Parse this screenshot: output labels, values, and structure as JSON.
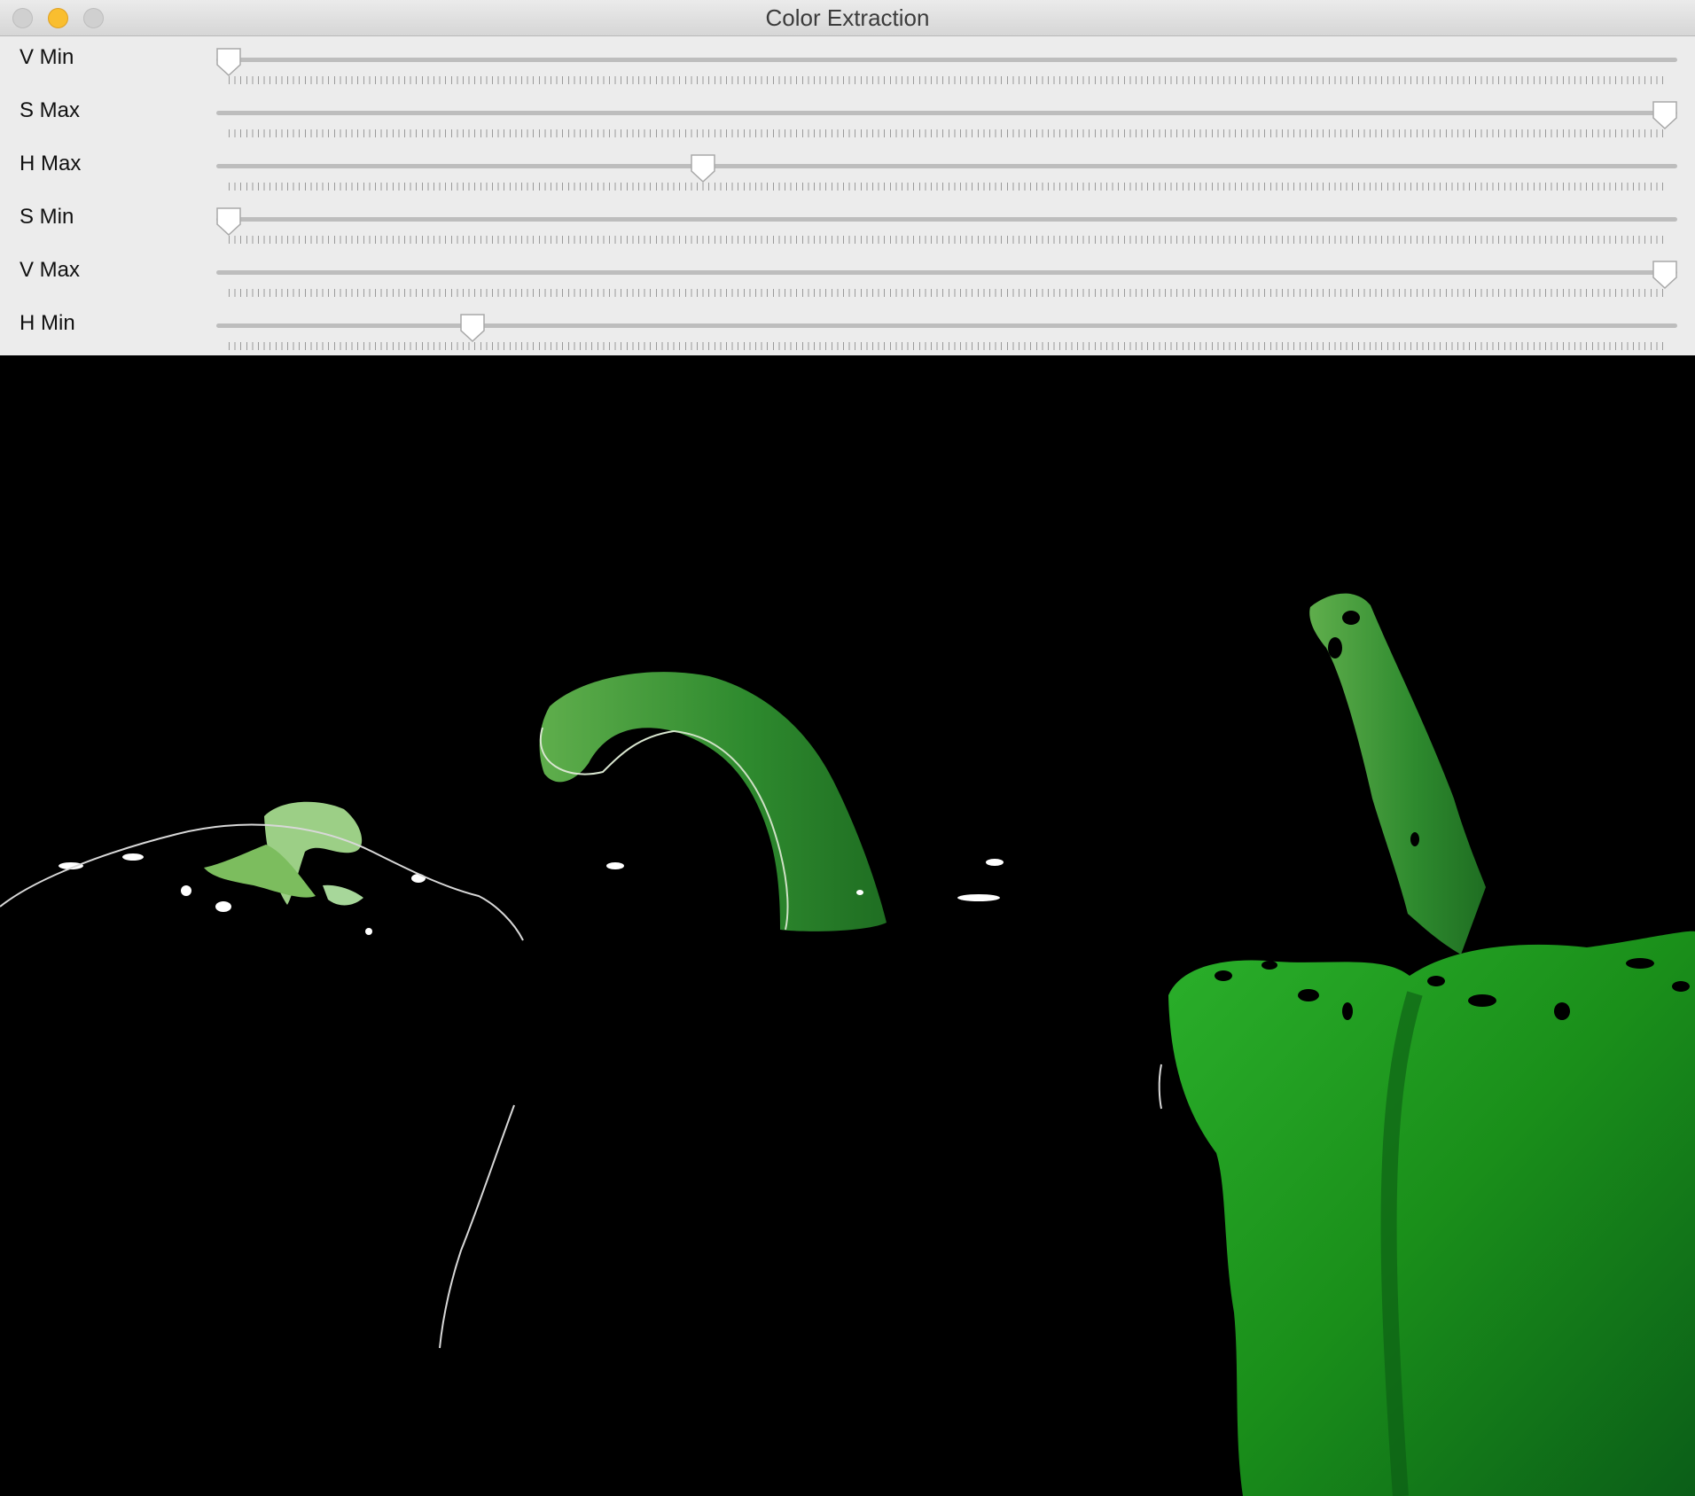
{
  "window": {
    "title": "Color Extraction"
  },
  "sliders": [
    {
      "label": "V Min",
      "value": 0.0
    },
    {
      "label": "S Max",
      "value": 1.0
    },
    {
      "label": "H Max",
      "value": 0.33
    },
    {
      "label": "S Min",
      "value": 0.0
    },
    {
      "label": "V Max",
      "value": 1.0
    },
    {
      "label": "H Min",
      "value": 0.17
    }
  ],
  "colors": {
    "titlebar": "#e0e0e0",
    "panel": "#ececec",
    "track": "#bdbdbd",
    "pepper_green": "#1e9a1e",
    "background": "#000000"
  }
}
